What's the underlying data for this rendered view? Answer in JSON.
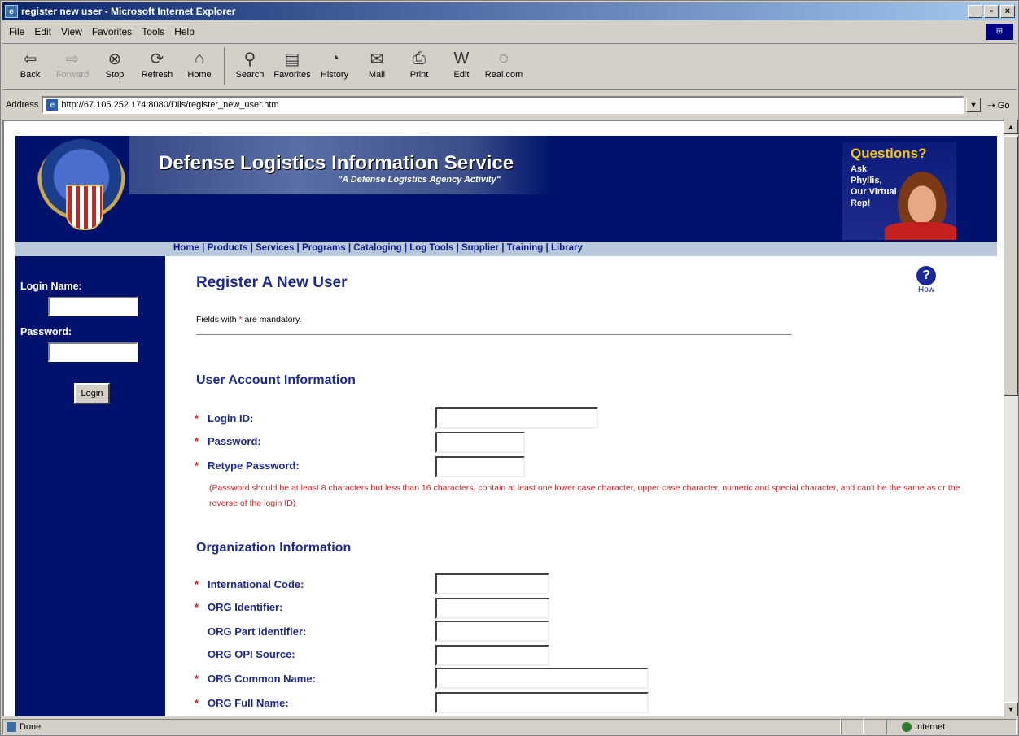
{
  "window": {
    "title": "register new user - Microsoft Internet Explorer"
  },
  "menu": [
    "File",
    "Edit",
    "View",
    "Favorites",
    "Tools",
    "Help"
  ],
  "toolbar": {
    "back": "Back",
    "forward": "Forward",
    "stop": "Stop",
    "refresh": "Refresh",
    "home": "Home",
    "search": "Search",
    "favorites": "Favorites",
    "history": "History",
    "mail": "Mail",
    "print": "Print",
    "edit": "Edit",
    "real": "Real.com"
  },
  "address": {
    "label": "Address",
    "url": "http://67.105.252.174:8080/Dlis/register_new_user.htm",
    "go": "Go"
  },
  "status": {
    "text": "Done",
    "zone": "Internet"
  },
  "banner": {
    "title": "Defense Logistics Information Service",
    "subtitle": "\"A Defense Logistics Agency Activity\"",
    "questions": "Questions?",
    "ask": "Ask Phyllis, Our Virtual Rep!"
  },
  "nav": [
    "Home",
    "Products",
    "Services",
    "Programs",
    "Cataloging",
    "Log Tools",
    "Supplier",
    "Training",
    "Library"
  ],
  "sidebar": {
    "login_name": "Login Name:",
    "password": "Password:",
    "login_button": "Login"
  },
  "page": {
    "title": "Register A New User",
    "help": "How",
    "note_prefix": "Fields with",
    "note_suffix": "are mandatory.",
    "asterisk": "*"
  },
  "account": {
    "heading": "User Account Information",
    "login_id": "Login ID:",
    "password": "Password:",
    "retype": "Retype Password:",
    "rule": "(Password should be at least 8 characters but less than 16 characters, contain at least one lower case character, upper case character, numeric and special character, and can't be the same as or the reverse of the login ID)"
  },
  "org": {
    "heading": "Organization Information",
    "intl_code": "International Code:",
    "org_id": "ORG Identifier:",
    "org_part": "ORG Part Identifier:",
    "org_opi": "ORG OPI Source:",
    "org_common": "ORG Common Name:",
    "org_full": "ORG Full Name:"
  }
}
